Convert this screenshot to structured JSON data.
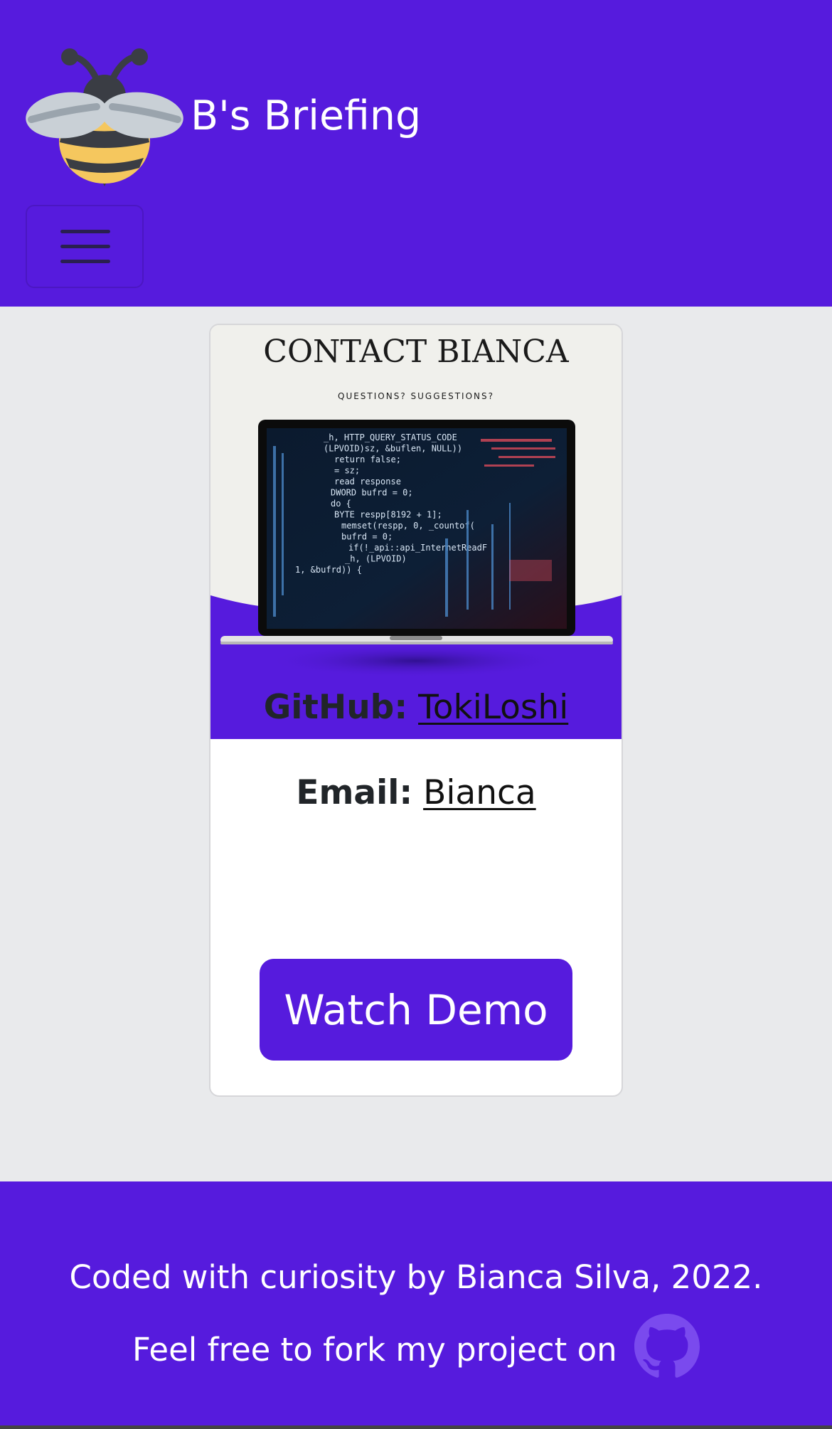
{
  "navbar": {
    "brand_name": "B's Briefing",
    "logo_icon": "bee-icon",
    "toggler_icon": "hamburger-menu-icon",
    "background": "#561bdd"
  },
  "card": {
    "image": {
      "title": "CONTACT BIANCA",
      "subtitle": "QUESTIONS? SUGGESTIONS?",
      "code_lines": [
        "_h, HTTP_QUERY_STATUS_CODE",
        "(LPVOID)sz, &buflen, NULL))",
        "return false;",
        "= sz;",
        "read response",
        "DWORD bufrd = 0;",
        "do {",
        "BYTE respp[8192 + 1];",
        "memset(respp, 0, _countof(",
        "bufrd = 0;",
        "if(!_api::api_InternetReadF",
        "_h, (LPVOID)",
        "1, &bufrd)) {"
      ]
    },
    "github": {
      "label": "GitHub:",
      "link_text": "TokiLoshi"
    },
    "email": {
      "label": "Email:",
      "link_text": "Bianca"
    },
    "demo_button": "Watch Demo"
  },
  "footer": {
    "text": "Coded with curiosity by Bianca Silva, 2022. Feel free to fork my project on",
    "icon": "github-icon"
  },
  "colors": {
    "accent": "#561bdd",
    "page_background": "#e9eaec",
    "text": "#212529"
  }
}
